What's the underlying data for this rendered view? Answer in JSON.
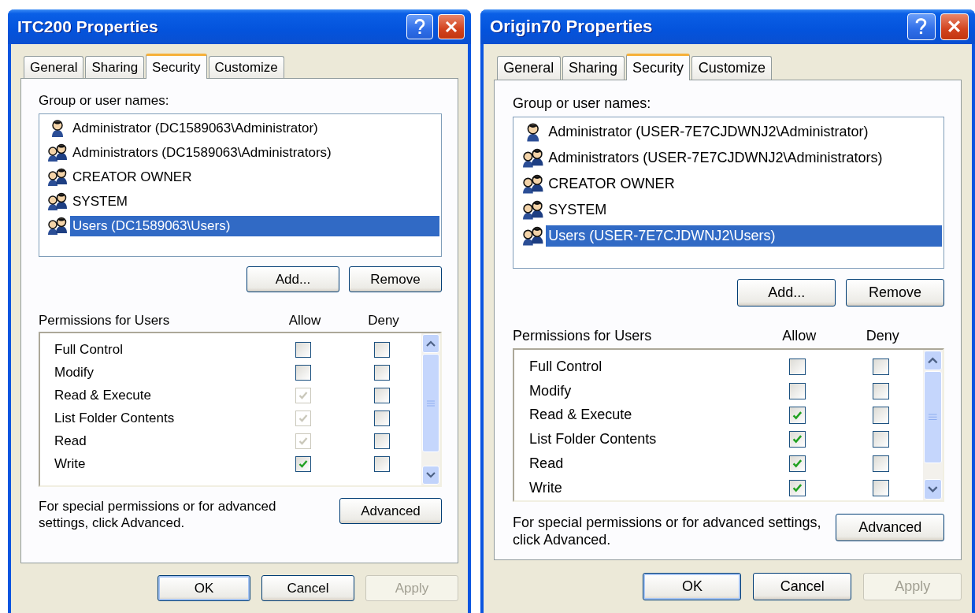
{
  "dialogs": [
    {
      "title": "ITC200 Properties",
      "tabs": [
        {
          "label": "General",
          "selected": false
        },
        {
          "label": "Sharing",
          "selected": false
        },
        {
          "label": "Security",
          "selected": true
        },
        {
          "label": "Customize",
          "selected": false
        }
      ],
      "group_label": "Group or user names:",
      "users": [
        {
          "kind": "user",
          "name": "Administrator (DC1589063\\Administrator)",
          "selected": false
        },
        {
          "kind": "group",
          "name": "Administrators (DC1589063\\Administrators)",
          "selected": false
        },
        {
          "kind": "group",
          "name": "CREATOR OWNER",
          "selected": false
        },
        {
          "kind": "group",
          "name": "SYSTEM",
          "selected": false
        },
        {
          "kind": "group",
          "name": "Users (DC1589063\\Users)",
          "selected": true
        }
      ],
      "user_buttons": [
        "Add...",
        "Remove"
      ],
      "permissions_label": "Permissions for Users",
      "allow_header": "Allow",
      "deny_header": "Deny",
      "permissions": [
        {
          "name": "Full Control",
          "allow": {
            "checked": false,
            "disabled": false
          },
          "deny": {
            "checked": false,
            "disabled": false
          }
        },
        {
          "name": "Modify",
          "allow": {
            "checked": false,
            "disabled": false
          },
          "deny": {
            "checked": false,
            "disabled": false
          }
        },
        {
          "name": "Read & Execute",
          "allow": {
            "checked": true,
            "disabled": true
          },
          "deny": {
            "checked": false,
            "disabled": false
          }
        },
        {
          "name": "List Folder Contents",
          "allow": {
            "checked": true,
            "disabled": true
          },
          "deny": {
            "checked": false,
            "disabled": false
          }
        },
        {
          "name": "Read",
          "allow": {
            "checked": true,
            "disabled": true
          },
          "deny": {
            "checked": false,
            "disabled": false
          }
        },
        {
          "name": "Write",
          "allow": {
            "checked": true,
            "disabled": false
          },
          "deny": {
            "checked": false,
            "disabled": false
          }
        }
      ],
      "advanced_note": "For special permissions or for advanced settings, click Advanced.",
      "advanced_button": "Advanced",
      "buttons": [
        {
          "label": "OK",
          "disabled": false
        },
        {
          "label": "Cancel",
          "disabled": false
        },
        {
          "label": "Apply",
          "disabled": true
        }
      ]
    },
    {
      "title": "Origin70 Properties",
      "tabs": [
        {
          "label": "General",
          "selected": false
        },
        {
          "label": "Sharing",
          "selected": false
        },
        {
          "label": "Security",
          "selected": true
        },
        {
          "label": "Customize",
          "selected": false
        }
      ],
      "group_label": "Group or user names:",
      "users": [
        {
          "kind": "user",
          "name": "Administrator (USER-7E7CJDWNJ2\\Administrator)",
          "selected": false
        },
        {
          "kind": "group",
          "name": "Administrators (USER-7E7CJDWNJ2\\Administrators)",
          "selected": false
        },
        {
          "kind": "group",
          "name": "CREATOR OWNER",
          "selected": false
        },
        {
          "kind": "group",
          "name": "SYSTEM",
          "selected": false
        },
        {
          "kind": "group",
          "name": "Users (USER-7E7CJDWNJ2\\Users)",
          "selected": true
        }
      ],
      "user_buttons": [
        "Add...",
        "Remove"
      ],
      "permissions_label": "Permissions for Users",
      "allow_header": "Allow",
      "deny_header": "Deny",
      "permissions": [
        {
          "name": "Full Control",
          "allow": {
            "checked": false,
            "disabled": false
          },
          "deny": {
            "checked": false,
            "disabled": false
          }
        },
        {
          "name": "Modify",
          "allow": {
            "checked": false,
            "disabled": false
          },
          "deny": {
            "checked": false,
            "disabled": false
          }
        },
        {
          "name": "Read & Execute",
          "allow": {
            "checked": true,
            "disabled": false
          },
          "deny": {
            "checked": false,
            "disabled": false
          }
        },
        {
          "name": "List Folder Contents",
          "allow": {
            "checked": true,
            "disabled": false
          },
          "deny": {
            "checked": false,
            "disabled": false
          }
        },
        {
          "name": "Read",
          "allow": {
            "checked": true,
            "disabled": false
          },
          "deny": {
            "checked": false,
            "disabled": false
          }
        },
        {
          "name": "Write",
          "allow": {
            "checked": true,
            "disabled": false
          },
          "deny": {
            "checked": false,
            "disabled": false
          }
        }
      ],
      "advanced_note": "For special permissions or for advanced settings, click Advanced.",
      "advanced_button": "Advanced",
      "buttons": [
        {
          "label": "OK",
          "disabled": false
        },
        {
          "label": "Cancel",
          "disabled": false
        },
        {
          "label": "Apply",
          "disabled": true
        }
      ]
    }
  ]
}
